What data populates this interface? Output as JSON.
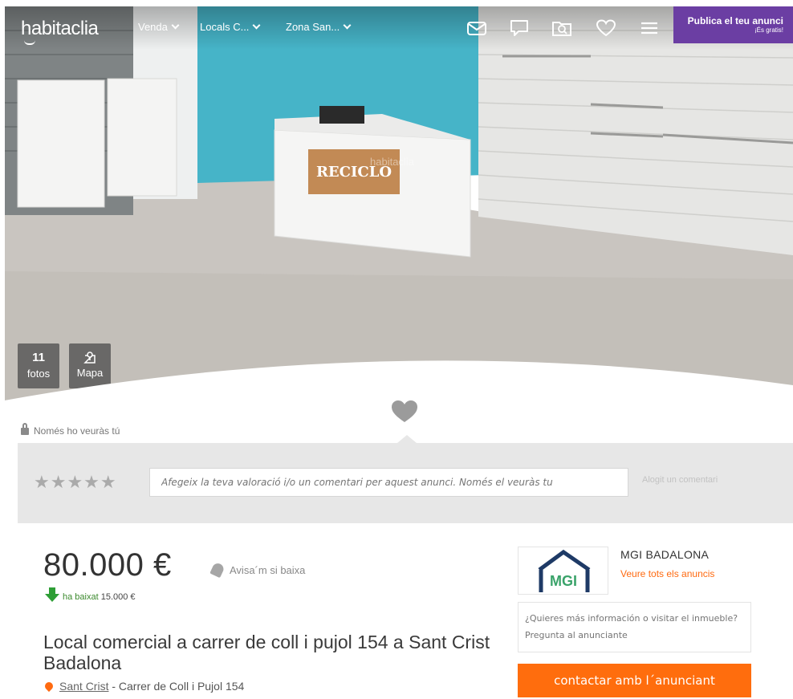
{
  "header": {
    "logo": "habitaclia",
    "nav": [
      {
        "label": "Venda"
      },
      {
        "label": "Locals C..."
      },
      {
        "label": "Zona San..."
      }
    ],
    "icons": [
      "mail-icon",
      "chat-icon",
      "saved-search-icon",
      "heart-icon",
      "menu-icon"
    ],
    "publish": {
      "line1": "Publica el teu anunci",
      "line2": "¡És gratis!"
    }
  },
  "gallery": {
    "photos_count": "11",
    "photos_label": "fotos",
    "map_label": "Mapa",
    "watermark": "habitaclia"
  },
  "notes": {
    "private_label": "Només ho veuràs tú",
    "rating_stars": 5,
    "comment_placeholder": "Afegeix la teva valoració i/o un comentari per aquest anunci. Només el veuràs tu",
    "save_label": "Alogit un comentari"
  },
  "listing": {
    "price": "80.000 €",
    "alert_label": "Avisa´m si baixa",
    "drop_label": "ha baixat",
    "drop_amount": "15.000 €",
    "title": "Local comercial a carrer de coll i pujol 154 a Sant Crist Badalona",
    "zone": "Sant Crist",
    "street": " - Carrer de Coll i Pujol 154"
  },
  "agency": {
    "logo_text": "MGI",
    "name": "MGI BADALONA",
    "all_ads_link": "Veure tots els anuncis",
    "contact_placeholder": "¿Quieres más información o visitar el inmueble? Pregunta al anunciante",
    "contact_button": "contactar amb l´anunciant"
  },
  "colors": {
    "brand_purple": "#6b3ea3",
    "accent_orange": "#ff6d0d",
    "price_drop_green": "#2e9e36"
  }
}
